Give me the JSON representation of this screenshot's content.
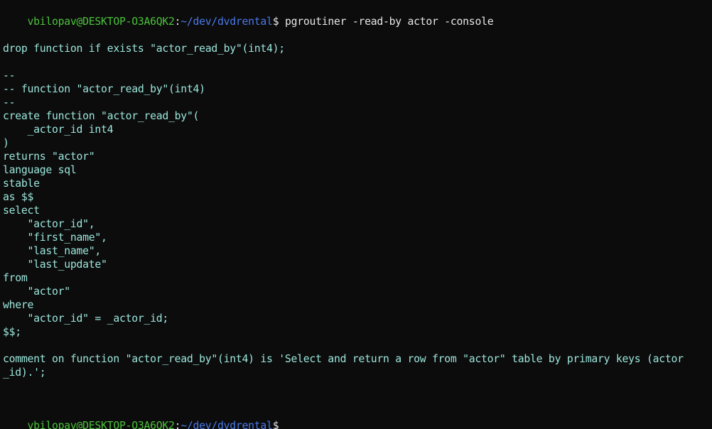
{
  "terminal": {
    "prompt": {
      "user_host": "vbilopav@DESKTOP-O3A6QK2",
      "separator": ":",
      "path": "~/dev/dvdrental",
      "symbol": "$"
    },
    "command": " pgroutiner -read-by actor -console",
    "output": [
      "drop function if exists \"actor_read_by\"(int4);",
      "--",
      "-- function \"actor_read_by\"(int4)",
      "--",
      "create function \"actor_read_by\"(",
      "    _actor_id int4",
      ")",
      "returns \"actor\"",
      "language sql",
      "stable",
      "as $$",
      "select",
      "    \"actor_id\",",
      "    \"first_name\",",
      "    \"last_name\",",
      "    \"last_update\"",
      "from",
      "    \"actor\"",
      "where",
      "    \"actor_id\" = _actor_id;",
      "$$;",
      "comment on function \"actor_read_by\"(int4) is 'Select and return a row from \"actor\" table by primary keys (actor",
      "_id).';"
    ]
  },
  "colors": {
    "background": "#0c0c0c",
    "output_text": "#9ce6dc",
    "command_text": "#e6e6e6",
    "user_host": "#4bc13a",
    "path": "#4a78e8"
  }
}
